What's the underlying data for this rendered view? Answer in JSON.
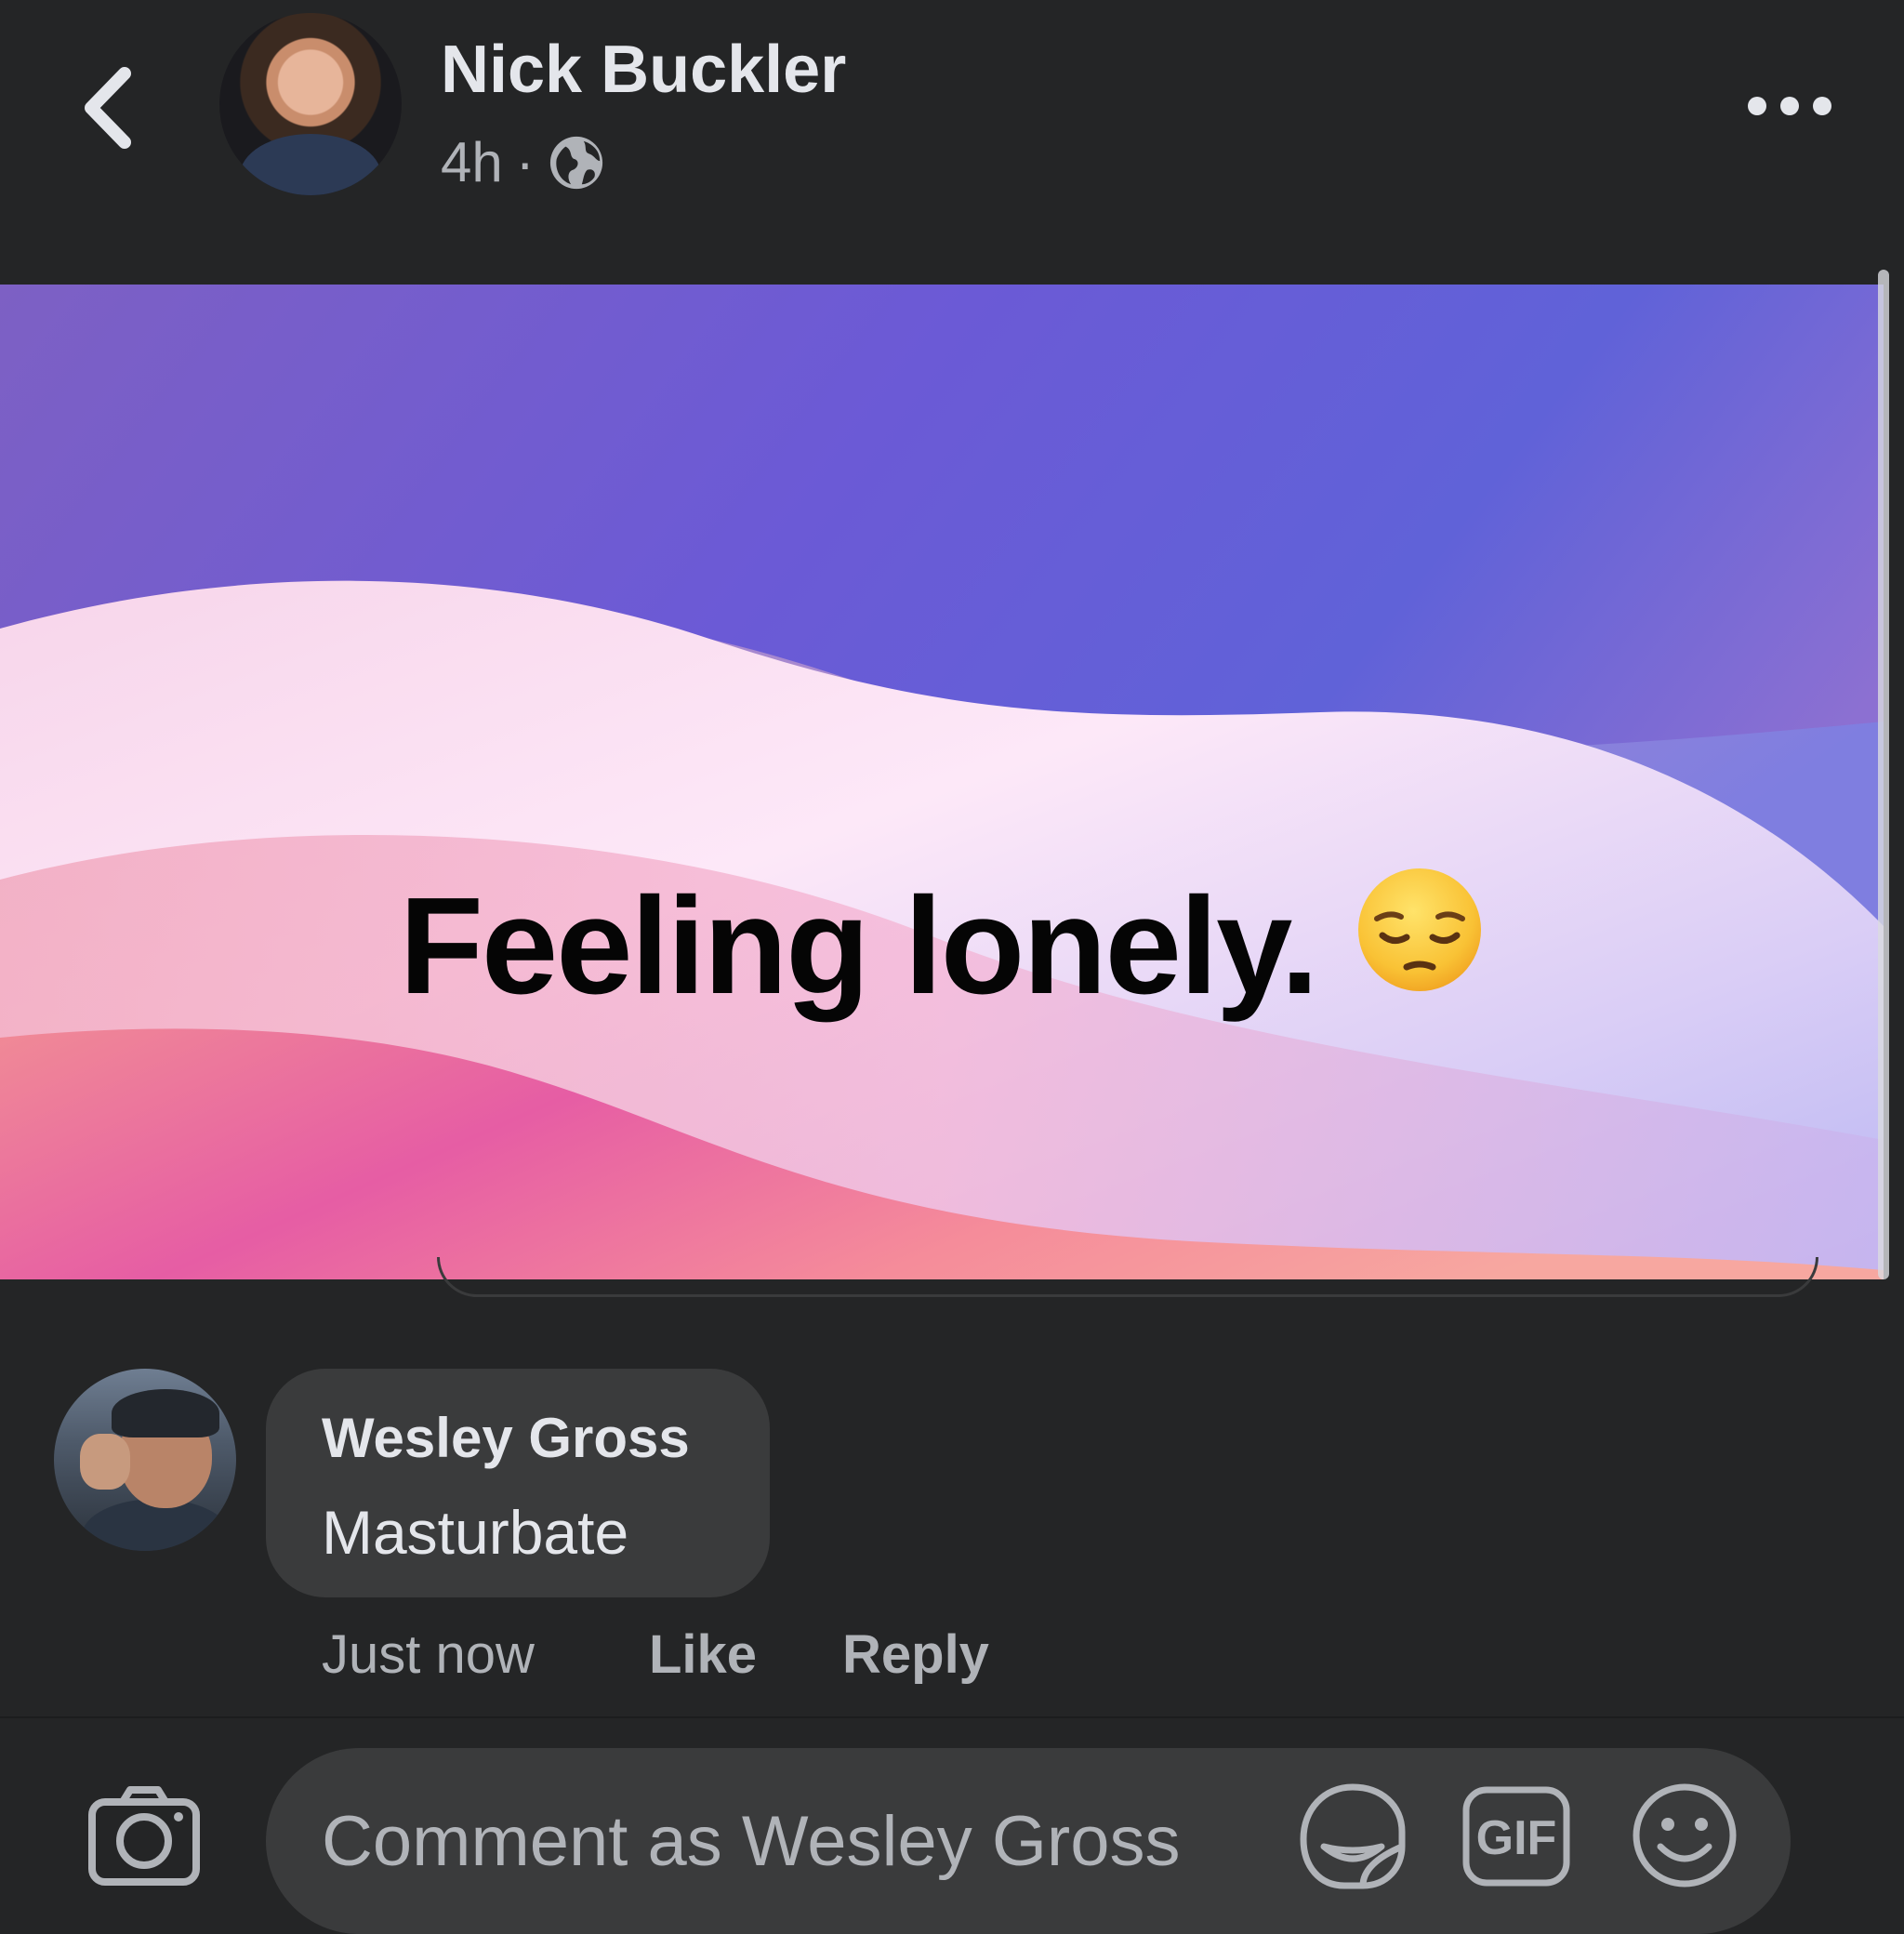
{
  "header": {
    "author_name": "Nick Buckler",
    "time": "4h",
    "separator": "·",
    "privacy_icon": "globe-icon",
    "back_icon": "chevron-left-icon",
    "more_icon": "more-horizontal-icon"
  },
  "post": {
    "text": "Feeling lonely.",
    "emoji": "😔",
    "background_colors": [
      "#7a5fd0",
      "#fde7f5",
      "#f08a8a",
      "#e25aa0"
    ]
  },
  "comment": {
    "author_name": "Wesley Gross",
    "text": "Masturbate",
    "time": "Just now",
    "like_label": "Like",
    "reply_label": "Reply"
  },
  "composer": {
    "placeholder": "Comment as Wesley Gross",
    "camera_icon": "camera-icon",
    "sticker_icon": "sticker-icon",
    "gif_label": "GIF",
    "emoji_icon": "emoji-icon"
  },
  "colors": {
    "background": "#242526",
    "bubble": "#3a3b3c",
    "primary_text": "#e4e6eb",
    "secondary_text": "#b0b3b8"
  }
}
